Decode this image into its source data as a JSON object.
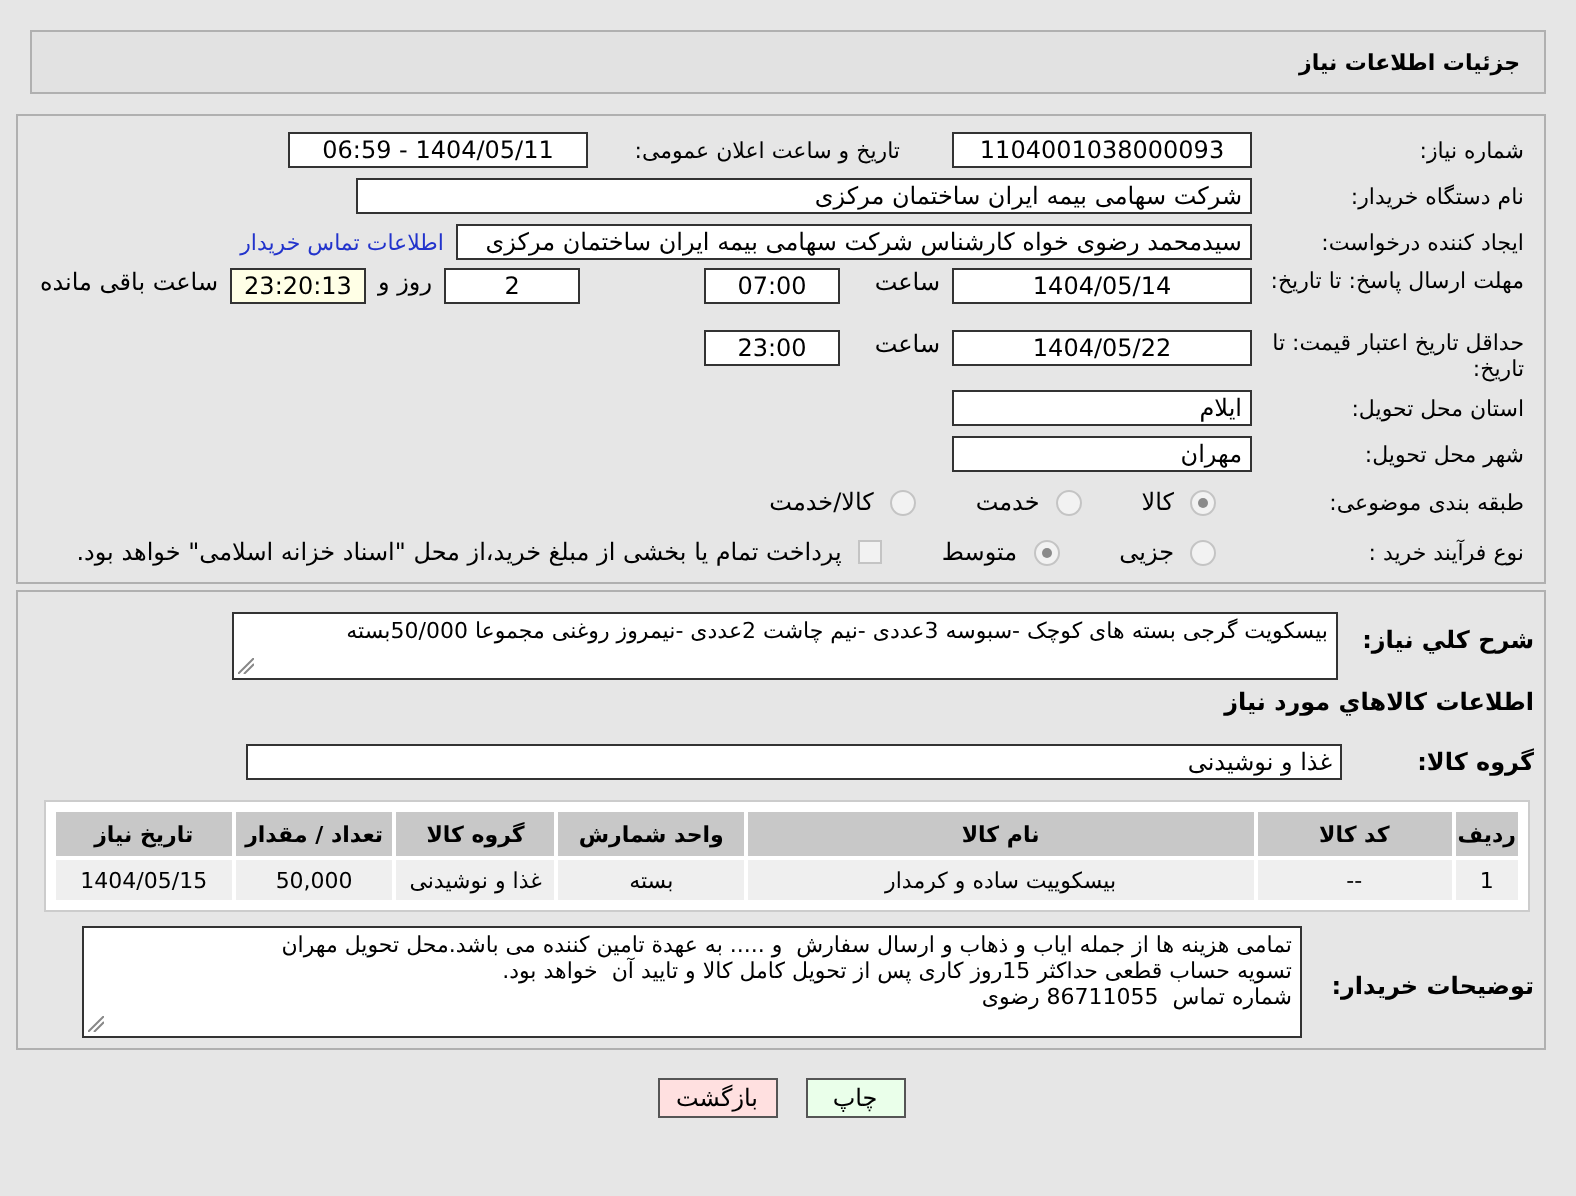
{
  "header": {
    "title": "جزئیات اطلاعات نیاز"
  },
  "info": {
    "need_number": {
      "label": "شماره نیاز:",
      "value": "1104001038000093"
    },
    "announce": {
      "label": "تاریخ و ساعت اعلان عمومی:",
      "value": "1404/05/11 - 06:59"
    },
    "buyer_org": {
      "label": "نام دستگاه خریدار:",
      "value": "شرکت سهامی بیمه ایران ساختمان مرکزی"
    },
    "requester": {
      "label": "ایجاد کننده درخواست:",
      "value": "سیدمحمد رضوی خواه کارشناس شرکت سهامی بیمه ایران ساختمان مرکزی",
      "link": "اطلاعات تماس خریدار"
    },
    "deadline": {
      "label": "مهلت ارسال پاسخ: تا تاریخ:",
      "date": "1404/05/14",
      "time_label": "ساعت",
      "time": "07:00",
      "days": "2",
      "days_label": "روز و",
      "remaining": "23:20:13",
      "remaining_label": "ساعت باقی مانده"
    },
    "validity": {
      "label": "حداقل تاریخ اعتبار قیمت: تا تاریخ:",
      "date": "1404/05/22",
      "time_label": "ساعت",
      "time": "23:00"
    },
    "province": {
      "label": "استان محل تحویل:",
      "value": "ایلام"
    },
    "city": {
      "label": "شهر محل تحویل:",
      "value": "مهران"
    },
    "category": {
      "label": "طبقه بندی موضوعی:",
      "options": [
        {
          "label": "کالا",
          "selected": true
        },
        {
          "label": "خدمت",
          "selected": false
        },
        {
          "label": "کالا/خدمت",
          "selected": false
        }
      ]
    },
    "purchase_type": {
      "label": "نوع فرآیند خرید :",
      "options": [
        {
          "label": "جزیی",
          "selected": false
        },
        {
          "label": "متوسط",
          "selected": true
        }
      ],
      "payment": {
        "checked": false,
        "text": "پرداخت تمام یا بخشی از مبلغ خرید،از محل \"اسناد خزانه اسلامی\" خواهد بود."
      }
    }
  },
  "goods": {
    "description": {
      "label": "شرح كلي نياز:",
      "value": "بیسکویت گرجی بسته های کوچک -سبوسه 3عددی -نیم چاشت 2عددی -نیمروز روغنی مجموعا 50/000بسته"
    },
    "section_title": "اطلاعات كالاهاي مورد نياز",
    "group": {
      "label": "گروه كالا:",
      "value": "غذا و نوشیدنی"
    },
    "table": {
      "columns": [
        "ردیف",
        "کد کالا",
        "نام کالا",
        "واحد شمارش",
        "گروه کالا",
        "تعداد / مقدار",
        "تاریخ نیاز"
      ],
      "rows": [
        [
          "1",
          "--",
          "بیسکوییت ساده و کرمدار",
          "بسته",
          "غذا و نوشیدنی",
          "50,000",
          "1404/05/15"
        ]
      ]
    },
    "notes": {
      "label": "توضیحات خریدار:",
      "value": "تمامی هزینه ها از جمله ایاب و ذهاب و ارسال سفارش  و ..... به عهدة تامین کننده می باشد.محل تحویل مهران\nتسویه حساب قطعی حداکثر 15روز کاری پس از تحویل کامل کالا و تایید آن  خواهد بود.\nشماره تماس  86711055 رضوی"
    }
  },
  "buttons": [
    {
      "kind": "print",
      "label": "چاپ"
    },
    {
      "kind": "back",
      "label": "بازگشت"
    }
  ]
}
